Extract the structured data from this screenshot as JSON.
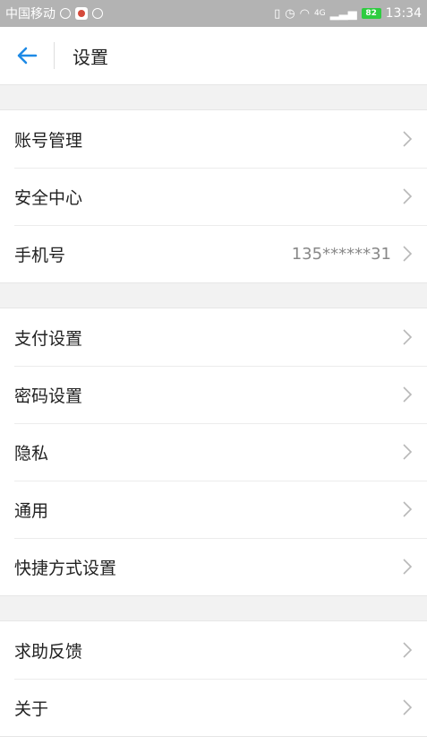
{
  "status_bar": {
    "carrier": "中国移动",
    "network": "4G",
    "battery": "82",
    "time": "13:34"
  },
  "header": {
    "title": "设置"
  },
  "groups": [
    {
      "items": [
        {
          "label": "账号管理",
          "value": ""
        },
        {
          "label": "安全中心",
          "value": ""
        },
        {
          "label": "手机号",
          "value": "135******31"
        }
      ]
    },
    {
      "items": [
        {
          "label": "支付设置",
          "value": ""
        },
        {
          "label": "密码设置",
          "value": ""
        },
        {
          "label": "隐私",
          "value": ""
        },
        {
          "label": "通用",
          "value": ""
        },
        {
          "label": "快捷方式设置",
          "value": ""
        }
      ]
    },
    {
      "items": [
        {
          "label": "求助反馈",
          "value": ""
        },
        {
          "label": "关于",
          "value": ""
        }
      ]
    }
  ],
  "colors": {
    "accent": "#1e8ae6",
    "status_bar_bg": "#b3b3b3",
    "battery": "#2ecc40"
  }
}
